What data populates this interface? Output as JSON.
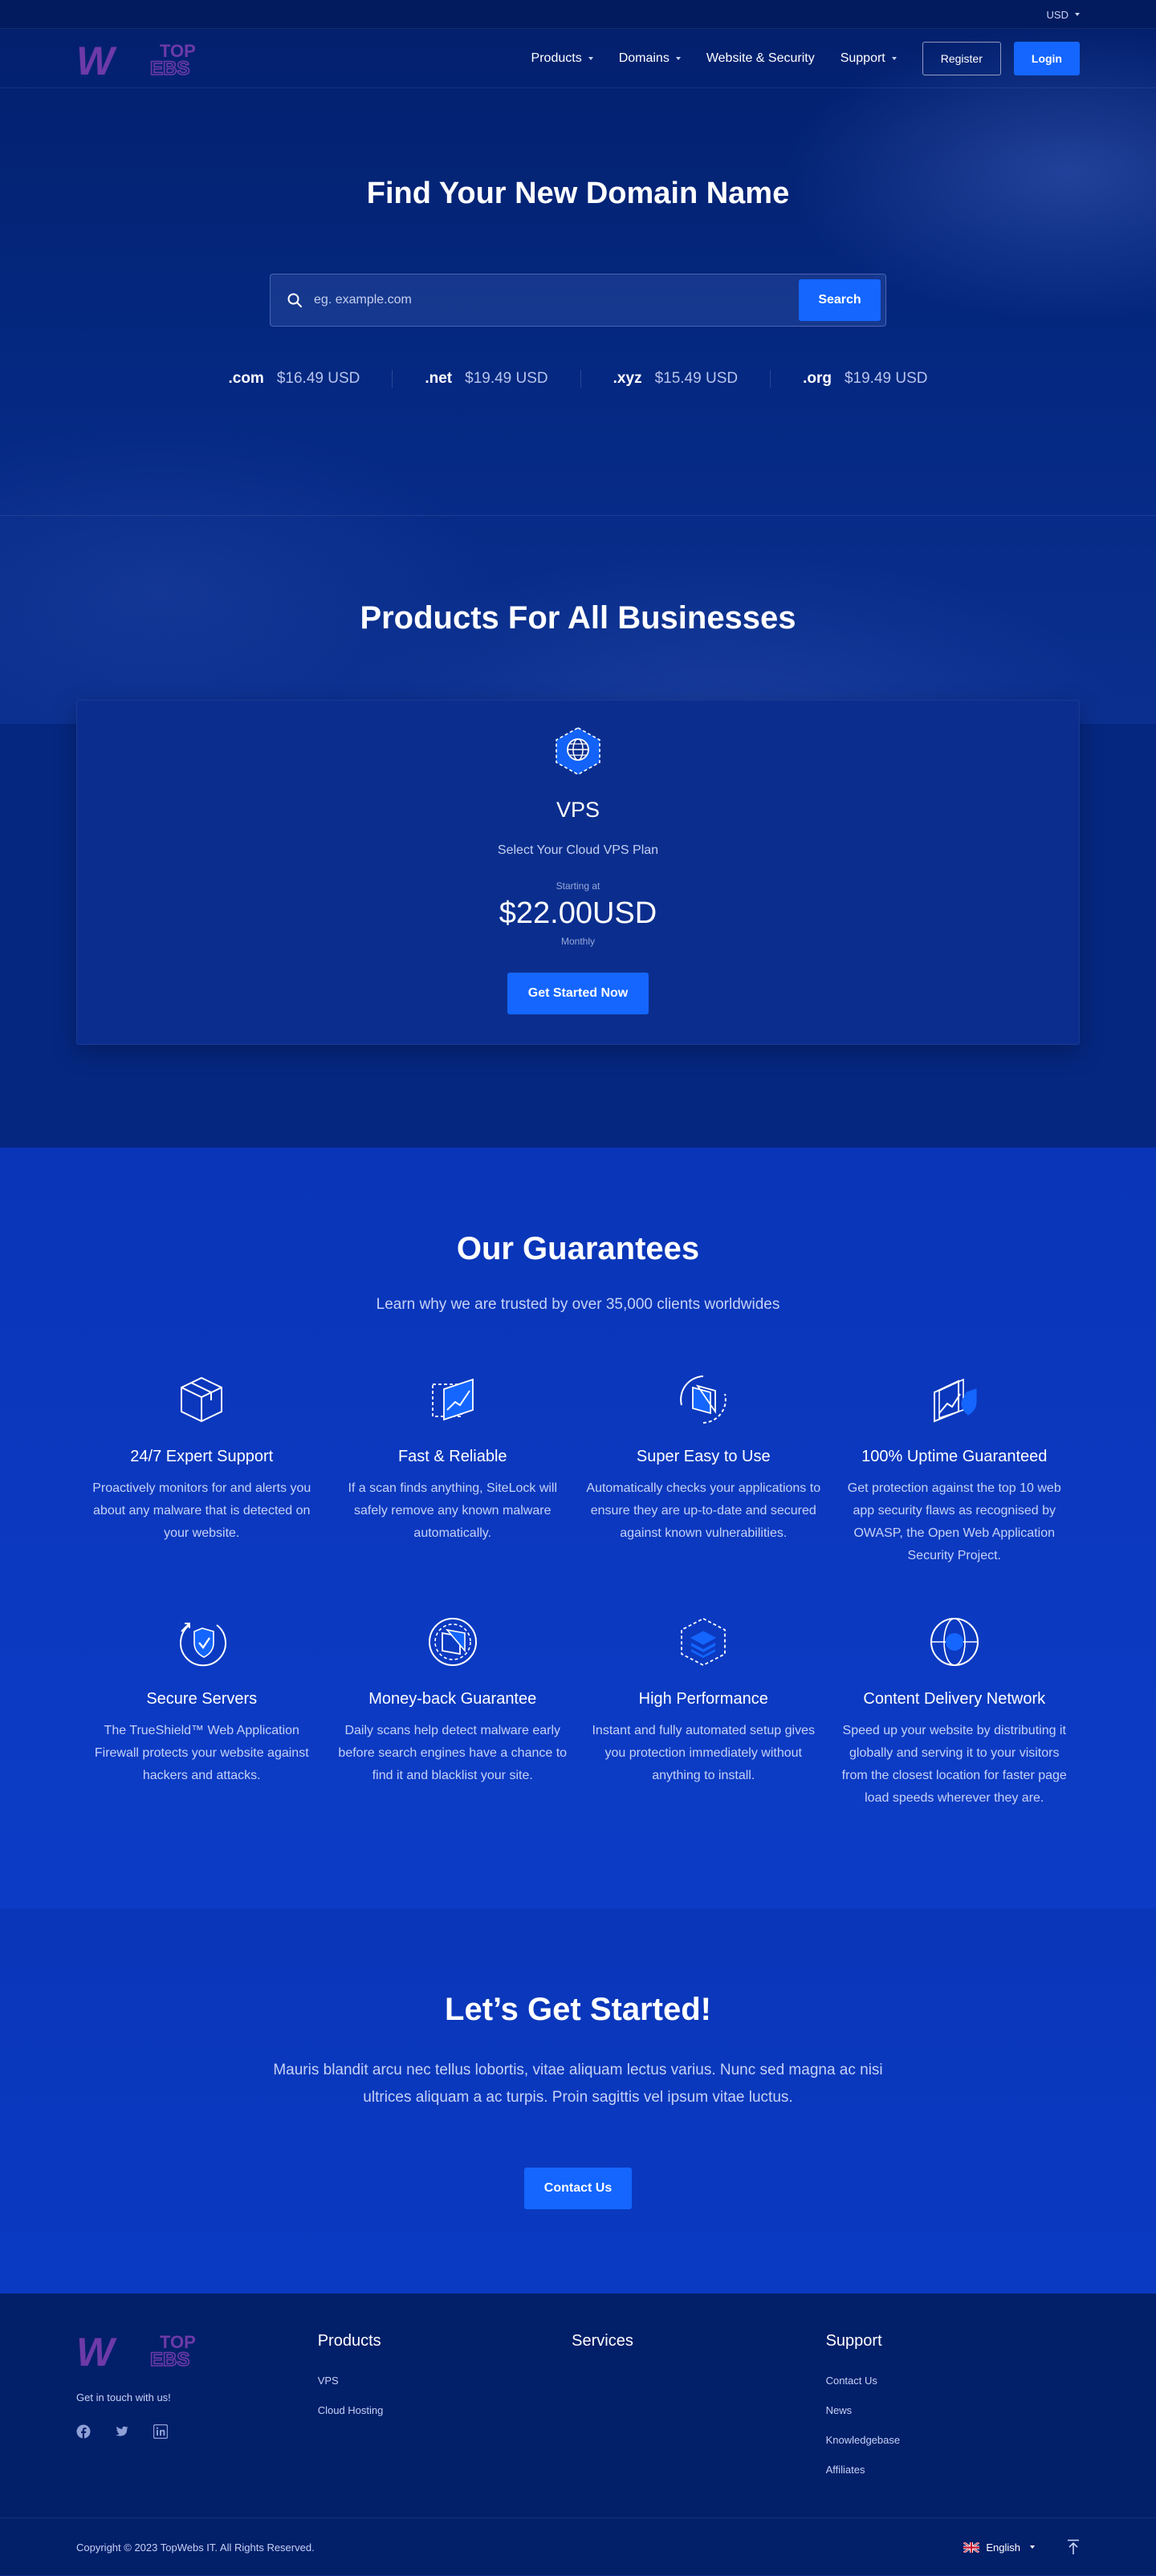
{
  "topbar": {
    "currency": "USD"
  },
  "nav": {
    "logo_text_top": "TOP",
    "logo_text_bottom": "EBS",
    "logo_letter": "W",
    "links": [
      "Products",
      "Domains",
      "Website & Security",
      "Support"
    ],
    "register": "Register",
    "login": "Login"
  },
  "hero": {
    "title": "Find Your New Domain Name",
    "search_placeholder": "eg. example.com",
    "search_button": "Search",
    "tlds": [
      {
        "name": ".com",
        "price": "$16.49 USD"
      },
      {
        "name": ".net",
        "price": "$19.49 USD"
      },
      {
        "name": ".xyz",
        "price": "$15.49 USD"
      },
      {
        "name": ".org",
        "price": "$19.49 USD"
      }
    ]
  },
  "products": {
    "title": "Products For All Businesses",
    "card": {
      "name": "VPS",
      "description": "Select Your Cloud VPS Plan",
      "starting_label": "Starting at",
      "price": "$22.00USD",
      "period": "Monthly",
      "button": "Get Started Now"
    }
  },
  "guarantees": {
    "title": "Our Guarantees",
    "subtitle": "Learn why we are trusted by over 35,000 clients worldwides",
    "items": [
      {
        "icon": "box-icon",
        "name": "24/7 Expert Support",
        "text": "Proactively monitors for and alerts you about any malware that is detected on your website."
      },
      {
        "icon": "chart-icon",
        "name": "Fast & Reliable",
        "text": "If a scan finds anything, SiteLock will safely remove any known malware automatically."
      },
      {
        "icon": "refresh-card-icon",
        "name": "Super Easy to Use",
        "text": "Automatically checks your applications to ensure they are up-to-date and secured against known vulnerabilities."
      },
      {
        "icon": "chart-shield-icon",
        "name": "100% Uptime Guaranteed",
        "text": "Get protection against the top 10 web app security flaws as recognised by OWASP, the Open Web Application Security Project."
      },
      {
        "icon": "shield-check-icon",
        "name": "Secure Servers",
        "text": "The TrueShield™ Web Application Firewall protects your website against hackers and attacks."
      },
      {
        "icon": "money-back-icon",
        "name": "Money-back Guarantee",
        "text": "Daily scans help detect malware early before search engines have a chance to find it and blacklist your site."
      },
      {
        "icon": "layers-icon",
        "name": "High Performance",
        "text": "Instant and fully automated setup gives you protection immediately without anything to install."
      },
      {
        "icon": "globe-icon",
        "name": "Content Delivery Network",
        "text": "Speed up your website by distributing it globally and serving it to your visitors from the closest location for faster page load speeds wherever they are."
      }
    ]
  },
  "started": {
    "title": "Let’s Get Started!",
    "text": "Mauris blandit arcu nec tellus lobortis, vitae aliquam lectus varius. Nunc sed magna ac nisi ultrices aliquam a ac turpis. Proin sagittis vel ipsum vitae luctus.",
    "button": "Contact Us"
  },
  "footer": {
    "touch": "Get in touch with us!",
    "columns": [
      {
        "title": "Products",
        "links": [
          "VPS",
          "Cloud Hosting"
        ]
      },
      {
        "title": "Services",
        "links": []
      },
      {
        "title": "Support",
        "links": [
          "Contact Us",
          "News",
          "Knowledgebase",
          "Affiliates"
        ]
      }
    ],
    "socials": [
      "facebook-icon",
      "twitter-icon",
      "linkedin-icon"
    ],
    "copyright": "Copyright © 2023 TopWebs IT. All Rights Reserved.",
    "language": "English"
  },
  "colors": {
    "accent": "#1466ff",
    "logo": "#6d3aa8",
    "hero_bg": "#03206e",
    "guarantees_bg": "#0a35b8",
    "footer_bg": "#021f6a"
  }
}
